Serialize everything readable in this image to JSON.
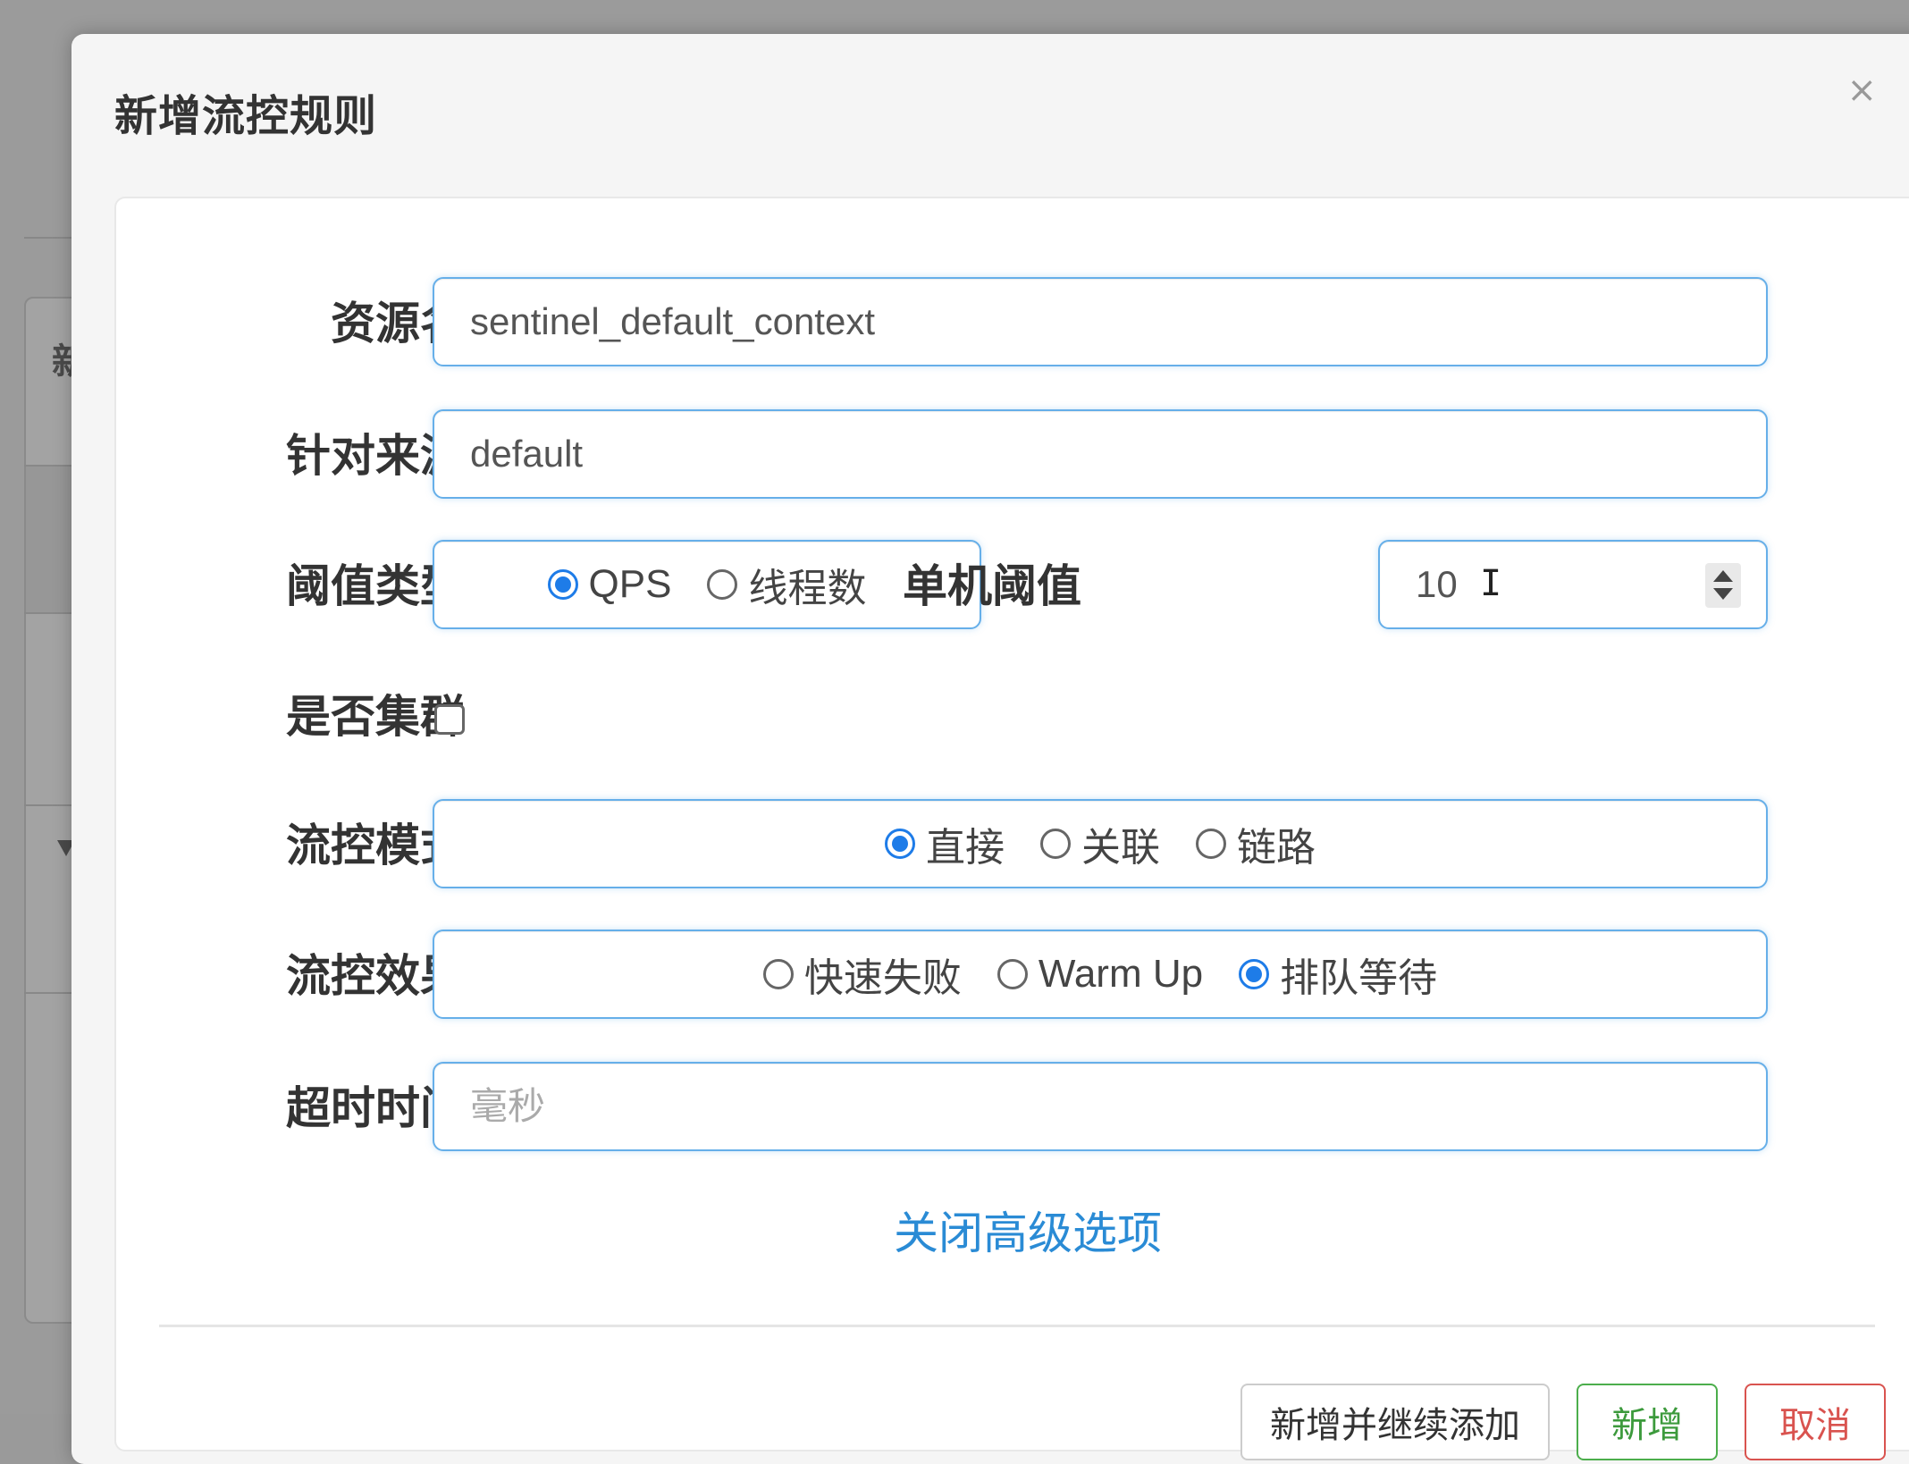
{
  "modal": {
    "title": "新增流控规则"
  },
  "form": {
    "resource": {
      "label": "资源名",
      "value": "sentinel_default_context"
    },
    "limit_app": {
      "label": "针对来源",
      "value": "default"
    },
    "grade": {
      "label": "阈值类型",
      "options": [
        "QPS",
        "线程数"
      ],
      "selected": "QPS"
    },
    "count": {
      "label": "单机阈值",
      "value": "10"
    },
    "cluster": {
      "label": "是否集群",
      "checked": false
    },
    "strategy": {
      "label": "流控模式",
      "options": [
        "直接",
        "关联",
        "链路"
      ],
      "selected": "直接"
    },
    "control_behavior": {
      "label": "流控效果",
      "options": [
        "快速失败",
        "Warm Up",
        "排队等待"
      ],
      "selected": "排队等待"
    },
    "timeout": {
      "label": "超时时间",
      "placeholder": "毫秒"
    },
    "advanced_toggle": "关闭高级选项"
  },
  "footer": {
    "add_continue_label": "新增并继续添加",
    "add_label": "新增",
    "cancel_label": "取消"
  },
  "colors": {
    "accent": "#1e7ce8",
    "link": "#2a8bd5",
    "success": "#3c9a3c",
    "danger": "#d9534f"
  }
}
